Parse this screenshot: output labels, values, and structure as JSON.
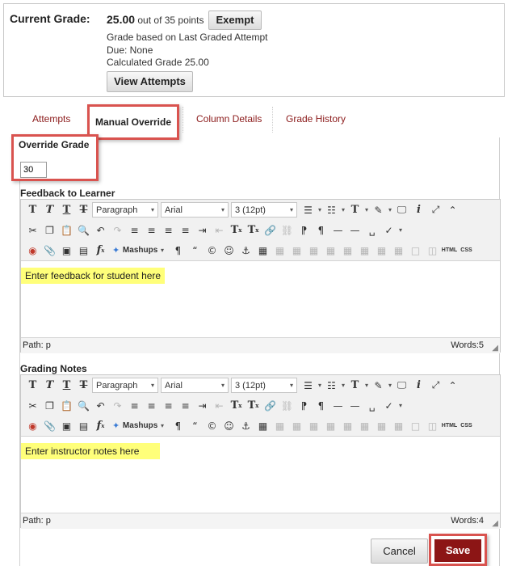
{
  "grade": {
    "label": "Current Grade:",
    "score": "25.00",
    "points_text": " out of 35 points",
    "exempt_button": "Exempt",
    "based_on": "Grade based on Last Graded Attempt",
    "due": "Due: None",
    "calculated": "Calculated Grade  25.00",
    "view_attempts_button": "View Attempts"
  },
  "tabs": [
    {
      "label": "Attempts"
    },
    {
      "label": "Manual Override",
      "active": true
    },
    {
      "label": "Column Details"
    },
    {
      "label": "Grade History"
    }
  ],
  "override": {
    "label": "Override Grade",
    "value": "30"
  },
  "feedback": {
    "label": "Feedback to Learner",
    "placeholder_text": "Enter feedback for student here",
    "path": "Path: p",
    "words": "Words:5"
  },
  "notes": {
    "label": "Grading Notes",
    "placeholder_text": "Enter instructor notes here",
    "path": "Path: p",
    "words": "Words:4"
  },
  "toolbar": {
    "format": "Paragraph",
    "font": "Arial",
    "size": "3 (12pt)",
    "mashups": "Mashups",
    "html": "HTML",
    "css": "CSS"
  },
  "actions": {
    "cancel": "Cancel",
    "save": "Save"
  },
  "colors": {
    "highlight_red": "#d9534f",
    "save_bg": "#8c1515",
    "tab_link": "#8b1a1a",
    "placeholder_bg": "#ffff7a"
  }
}
